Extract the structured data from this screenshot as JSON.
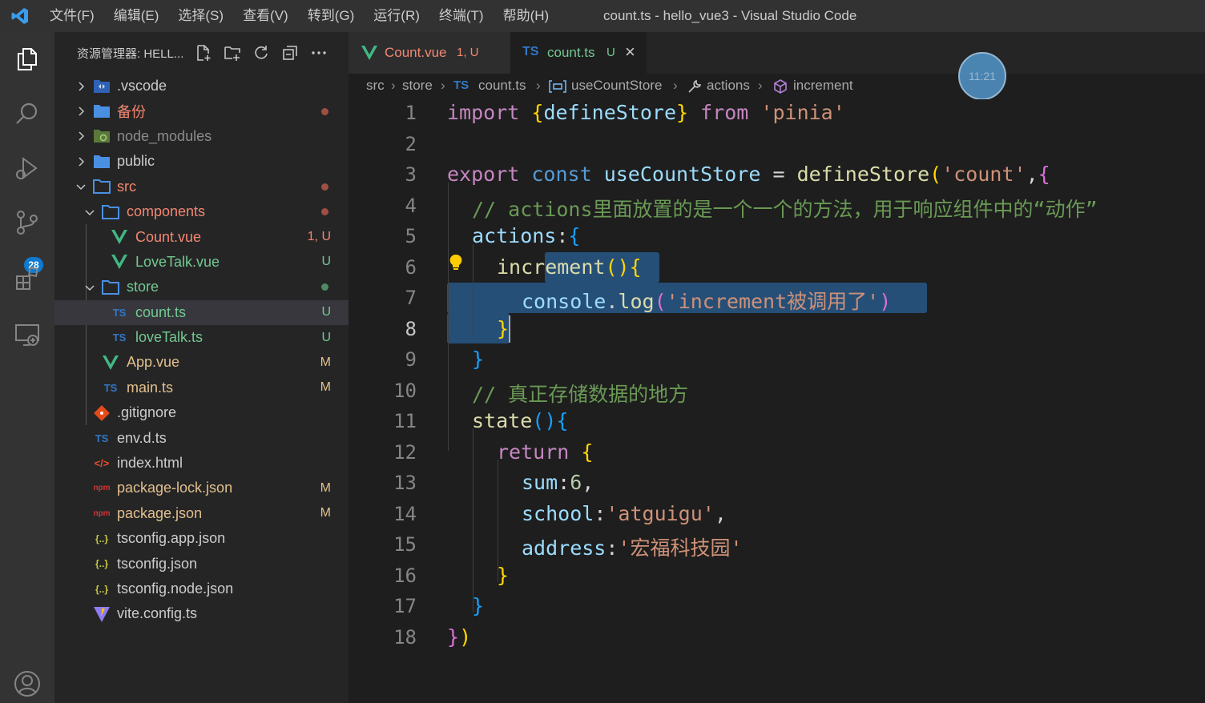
{
  "titlebar": {
    "menu": [
      "文件(F)",
      "编辑(E)",
      "选择(S)",
      "查看(V)",
      "转到(G)",
      "运行(R)",
      "终端(T)",
      "帮助(H)"
    ],
    "window_title": "count.ts - hello_vue3 - Visual Studio Code"
  },
  "activitybar": {
    "icons": [
      "explorer-icon",
      "search-icon",
      "run-debug-icon",
      "source-control-icon",
      "extensions-icon",
      "remote-explorer-icon",
      "account-icon"
    ],
    "scm_badge": "28"
  },
  "sidebar": {
    "title": "资源管理器: HELL...",
    "tree": [
      {
        "label": ".vscode",
        "status": ""
      },
      {
        "label": "备份",
        "status": ""
      },
      {
        "label": "node_modules",
        "status": ""
      },
      {
        "label": "public",
        "status": ""
      },
      {
        "label": "src",
        "status": ""
      },
      {
        "label": "components",
        "status": ""
      },
      {
        "label": "Count.vue",
        "status": "1, U"
      },
      {
        "label": "LoveTalk.vue",
        "status": "U"
      },
      {
        "label": "store",
        "status": ""
      },
      {
        "label": "count.ts",
        "status": "U"
      },
      {
        "label": "loveTalk.ts",
        "status": "U"
      },
      {
        "label": "App.vue",
        "status": "M"
      },
      {
        "label": "main.ts",
        "status": "M"
      },
      {
        "label": ".gitignore",
        "status": ""
      },
      {
        "label": "env.d.ts",
        "status": ""
      },
      {
        "label": "index.html",
        "status": ""
      },
      {
        "label": "package-lock.json",
        "status": "M"
      },
      {
        "label": "package.json",
        "status": "M"
      },
      {
        "label": "tsconfig.app.json",
        "status": ""
      },
      {
        "label": "tsconfig.json",
        "status": ""
      },
      {
        "label": "tsconfig.node.json",
        "status": ""
      },
      {
        "label": "vite.config.ts",
        "status": ""
      }
    ],
    "icon_text": {
      "ts": "TS",
      "npm": "npm",
      "json": "{..}",
      "html": "</>"
    }
  },
  "tabs": [
    {
      "name": "Count.vue",
      "status": "1, U",
      "active": false
    },
    {
      "name": "count.ts",
      "status": "U",
      "active": true,
      "close": "×"
    }
  ],
  "breadcrumb": [
    "src",
    "store",
    "count.ts",
    "useCountStore",
    "actions",
    "increment"
  ],
  "clock": "11:21",
  "colors": {
    "editor_bg": "#1e1e1e",
    "sidebar_bg": "#252526",
    "activity_bg": "#333333",
    "selection": "#264f78",
    "modified": "#e2c08d",
    "untracked": "#73c991",
    "error": "#f48771"
  },
  "editor": {
    "line_numbers": [
      "1",
      "2",
      "3",
      "4",
      "5",
      "6",
      "7",
      "8",
      "9",
      "10",
      "11",
      "12",
      "13",
      "14",
      "15",
      "16",
      "17",
      "18"
    ],
    "tokens": {
      "l1": [
        "import",
        "{",
        "defineStore",
        "}",
        "from",
        "'pinia'"
      ],
      "l3": [
        "export",
        "const",
        "useCountStore",
        "=",
        "defineStore",
        "(",
        "'count'",
        ",",
        "{"
      ],
      "l4": "// actions里面放置的是一个一个的方法，用于响应组件中的“动作”",
      "l5": [
        "actions",
        ":",
        "{"
      ],
      "l6": [
        "increment",
        "()",
        "{"
      ],
      "l7": [
        "console",
        ".",
        "log",
        "(",
        "'increment被调用了'",
        ")"
      ],
      "l8": "}",
      "l9": "}",
      "l10": "// 真正存储数据的地方",
      "l11": [
        "state",
        "()",
        "{"
      ],
      "l12": [
        "return",
        "{"
      ],
      "l13": [
        "sum",
        ":",
        "6",
        ","
      ],
      "l14": [
        "school",
        ":",
        "'atguigu'",
        ","
      ],
      "l15": [
        "address",
        ":",
        "'宏福科技园'"
      ],
      "l16": "}",
      "l17": "}",
      "l18": [
        "}",
        ")"
      ]
    }
  }
}
